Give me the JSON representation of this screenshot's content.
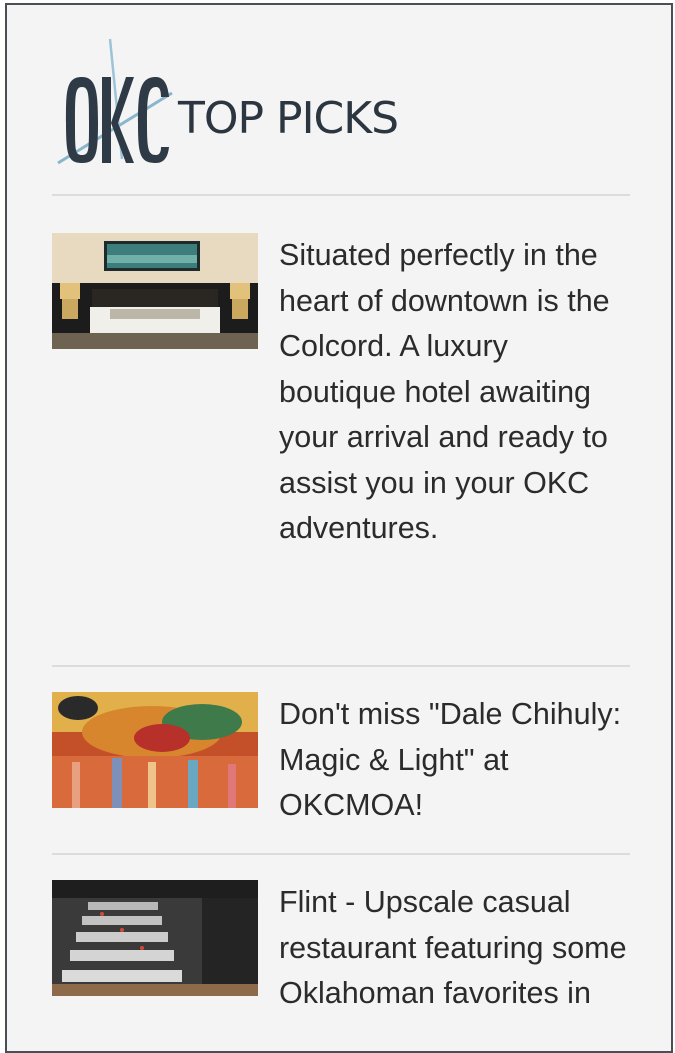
{
  "header": {
    "logo_letters": "OKC",
    "title": "TOP PICKS"
  },
  "picks": [
    {
      "image": "hotel-room-photo",
      "text": "Situated perfectly in the heart of downtown is the Colcord. A luxury boutique hotel awaiting your arrival and ready to assist you in your OKC adventures."
    },
    {
      "image": "glass-art-photo",
      "text": "Don't miss \"Dale Chihuly: Magic & Light\" at OKCMOA!"
    },
    {
      "image": "restaurant-photo",
      "text": "Flint - Upscale casual restaurant featuring some Oklahoman favorites in"
    }
  ],
  "colors": {
    "page_background": "#f4f4f4",
    "frame_border": "#4a4f55",
    "text": "#2b2b2b",
    "logo_dark": "#2e3b47",
    "logo_accent": "#8ab6cc",
    "divider": "#dcdcdc"
  }
}
